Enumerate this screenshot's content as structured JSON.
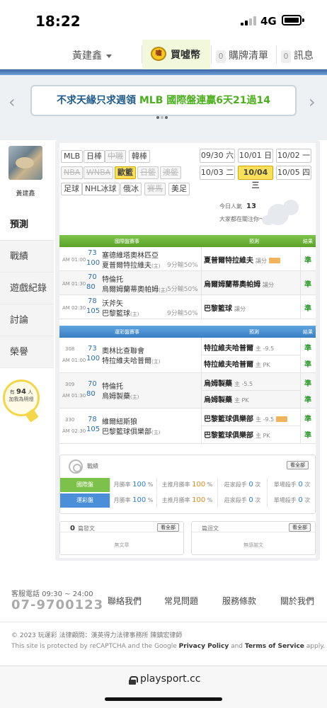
{
  "status_bar": {
    "time": "18:22",
    "network": "4G"
  },
  "top_nav": {
    "user": "黃建鑫",
    "coin_icon_text": "嘯",
    "coin_label": "買噓幣",
    "purchases": {
      "count": "0",
      "label": "購牌清單"
    },
    "messages": {
      "count": "0",
      "label": "訊息"
    }
  },
  "banner": {
    "text_blue": "不求天緣只求週領",
    "text_green": "MLB 國際盤連贏6天21過14",
    "prev_arrow": "‹",
    "next_arrow": "›"
  },
  "profile": {
    "name": "黃建鑫"
  },
  "side_menu": [
    "預測",
    "戰績",
    "遊戲紀錄",
    "討論",
    "榮譽"
  ],
  "fans": {
    "prefix": "有",
    "count": "94",
    "unit": "人",
    "suffix": "加我為明燈"
  },
  "leagues": [
    {
      "label": "MLB",
      "state": "normal"
    },
    {
      "label": "日棒",
      "state": "normal"
    },
    {
      "label": "中職",
      "state": "disabled"
    },
    {
      "label": "韓棒",
      "state": "normal"
    },
    {
      "label": "NBA",
      "state": "disabled"
    },
    {
      "label": "WNBA",
      "state": "disabled"
    },
    {
      "label": "歐籃",
      "state": "active"
    },
    {
      "label": "日籃",
      "state": "disabled"
    },
    {
      "label": "澳籃",
      "state": "disabled"
    },
    {
      "label": "足球",
      "state": "normal"
    },
    {
      "label": "NHL冰球",
      "state": "normal"
    },
    {
      "label": "俄冰",
      "state": "normal"
    },
    {
      "label": "賽馬",
      "state": "disabled"
    },
    {
      "label": "美足",
      "state": "normal"
    }
  ],
  "dates": [
    {
      "label": "09/30 六",
      "active": false
    },
    {
      "label": "10/01 日",
      "active": false
    },
    {
      "label": "10/02 一",
      "active": false
    },
    {
      "label": "10/03 二",
      "active": false
    },
    {
      "label": "10/04 三",
      "active": true
    },
    {
      "label": "10/05 四",
      "active": false
    }
  ],
  "popularity": {
    "label": "今日人氣",
    "value": "13",
    "caption": "大家都在關注你～"
  },
  "intl": {
    "head": {
      "match": "國際盤賽事",
      "pick": "預測",
      "result": "結果"
    },
    "rows": [
      {
        "time": "AM 01:00",
        "away_no": "73",
        "away": "塞德維塔奧林匹亞",
        "home_no": "100",
        "home": "夏普爾特拉維夫",
        "home_tag": "(主)",
        "spread": "9分輸50%",
        "pick": "夏普爾特拉維夫",
        "pick_sub": "讓分",
        "badge": true,
        "result": "準"
      },
      {
        "time": "AM 01:30",
        "away_no": "70",
        "away": "特倫托",
        "home_no": "80",
        "home": "烏爾姆蘭蒂奧帕姆",
        "home_tag": "(主)",
        "spread": "5分輸50%",
        "pick": "烏爾姆蘭蒂奧帕姆",
        "pick_sub": "讓分",
        "badge": false,
        "result": "準"
      },
      {
        "time": "AM 02:30",
        "away_no": "78",
        "away": "沃斧矢",
        "home_no": "105",
        "home": "巴黎籃球",
        "home_tag": "(主)",
        "spread": "9分輸50%",
        "pick": "巴黎籃球",
        "pick_sub": "讓分",
        "badge": false,
        "result": "準"
      }
    ]
  },
  "lottery": {
    "head": {
      "match": "運彩盤賽事",
      "pick": "預測",
      "result": "結果"
    },
    "rows": [
      {
        "game_no": "308",
        "time": "AM 01:00",
        "away_no": "73",
        "away": "奧林比查聯會",
        "home_no": "100",
        "home": "特拉維夫哈普爾",
        "home_tag": "(主)",
        "picks": [
          {
            "team": "特拉維夫哈普爾",
            "sub": "主 -9.5",
            "badge": false,
            "result": "準"
          },
          {
            "team": "特拉維夫哈普爾",
            "sub": "主 PK",
            "badge": false,
            "result": "準"
          }
        ]
      },
      {
        "game_no": "309",
        "time": "AM 01:30",
        "away_no": "70",
        "away": "特倫托",
        "home_no": "80",
        "home": "烏姆製藥",
        "home_tag": "(主)",
        "picks": [
          {
            "team": "烏姆製藥",
            "sub": "主 -5.5",
            "badge": false,
            "result": "準"
          },
          {
            "team": "烏姆製藥",
            "sub": "主 PK",
            "badge": false,
            "result": "準"
          }
        ]
      },
      {
        "game_no": "330",
        "time": "AM 02:30",
        "away_no": "78",
        "away": "維爾紐斯狼",
        "home_no": "105",
        "home": "巴黎籃球俱樂部",
        "home_tag": "(主)",
        "picks": [
          {
            "team": "巴黎籃球俱樂部",
            "sub": "主 -9.5",
            "badge": true,
            "result": "準"
          },
          {
            "team": "巴黎籃球俱樂部",
            "sub": "主 PK",
            "badge": false,
            "result": "準"
          }
        ]
      }
    ]
  },
  "record": {
    "title": "戰績",
    "see_all": "看全部",
    "rows": [
      {
        "label": "國際盤",
        "color": "#7cc14a",
        "month_rate_label": "月勝率",
        "month_rate": "100",
        "host_rate_label": "主推月勝率",
        "host_rate": "100",
        "killer_label": "莊家殺手",
        "killer": "0",
        "single_label": "單場殺手",
        "single": "0",
        "unit_pct": "%",
        "unit_times": "次"
      },
      {
        "label": "運彩盤",
        "color": "#4a8fd8",
        "month_rate_label": "月勝率",
        "month_rate": "100",
        "host_rate_label": "主推月勝率",
        "host_rate": "100",
        "killer_label": "莊家殺手",
        "killer": "0",
        "single_label": "單場殺手",
        "single": "0",
        "unit_pct": "%",
        "unit_times": "次"
      }
    ]
  },
  "posts": {
    "count": "0",
    "label": "篇發文",
    "see_all": "看全部",
    "empty": "無文章"
  },
  "replies": {
    "label": "篇迴文",
    "see_all": "看全部",
    "empty": "無感謝文"
  },
  "footer": {
    "service_label": "客服電話 09:30 ~ 24:00",
    "phone": "07-9700123",
    "links": [
      "聯絡我們",
      "常見問題",
      "服務條款",
      "關於我們"
    ],
    "copyright": "© 2023 玩運彩 法律顧問：漢英得力法律事務所 陳鎮宏律師",
    "captcha_pre": "This site is protected by reCAPTCHA and the Google ",
    "privacy": "Privacy Policy",
    "and": " and ",
    "terms": "Terms of Service",
    "apply": " apply."
  },
  "url_bar": {
    "url": "playsport.cc"
  }
}
